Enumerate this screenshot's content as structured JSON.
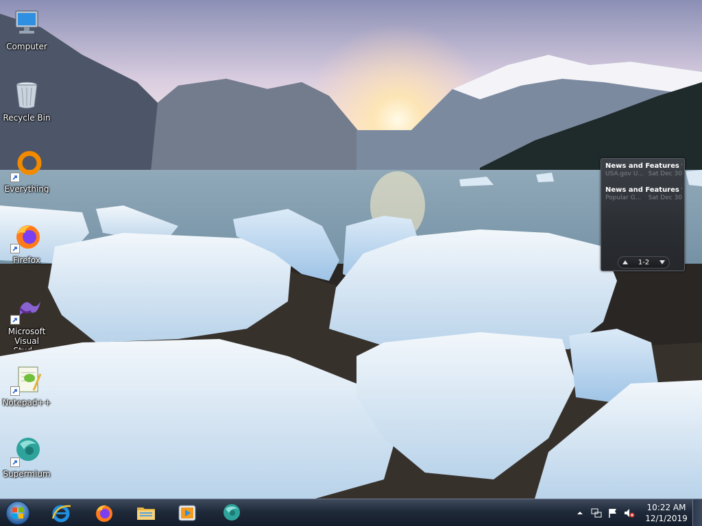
{
  "desktop": {
    "icons": [
      {
        "label": "Computer",
        "icon": "computer-icon",
        "shortcut": false
      },
      {
        "label": "Recycle Bin",
        "icon": "recycle-bin-icon",
        "shortcut": false
      },
      {
        "label": "Everything",
        "icon": "everything-icon",
        "shortcut": true
      },
      {
        "label": "Firefox",
        "icon": "firefox-icon",
        "shortcut": true
      },
      {
        "label": "Microsoft Visual Stud...",
        "icon": "visual-studio-icon",
        "shortcut": true
      },
      {
        "label": "Notepad++",
        "icon": "notepad-plus-plus-icon",
        "shortcut": true
      },
      {
        "label": "Supermium",
        "icon": "supermium-icon",
        "shortcut": true
      }
    ]
  },
  "gadget": {
    "items": [
      {
        "title": "News and Features f...",
        "source": "USA.gov U...",
        "date": "Sat Dec 30"
      },
      {
        "title": "News and Features f...",
        "source": "Popular G...",
        "date": "Sat Dec 30"
      }
    ],
    "page": "1-2"
  },
  "taskbar": {
    "pinned": [
      {
        "name": "internet-explorer-icon"
      },
      {
        "name": "firefox-icon"
      },
      {
        "name": "file-explorer-icon"
      },
      {
        "name": "media-player-icon"
      },
      {
        "name": "supermium-icon"
      }
    ],
    "clock": {
      "time": "10:22 AM",
      "date": "12/1/2019"
    }
  },
  "colors": {
    "taskbar": "#1f2a3a",
    "everything_orange": "#f28a00",
    "supermium_teal": "#2ea39c"
  }
}
